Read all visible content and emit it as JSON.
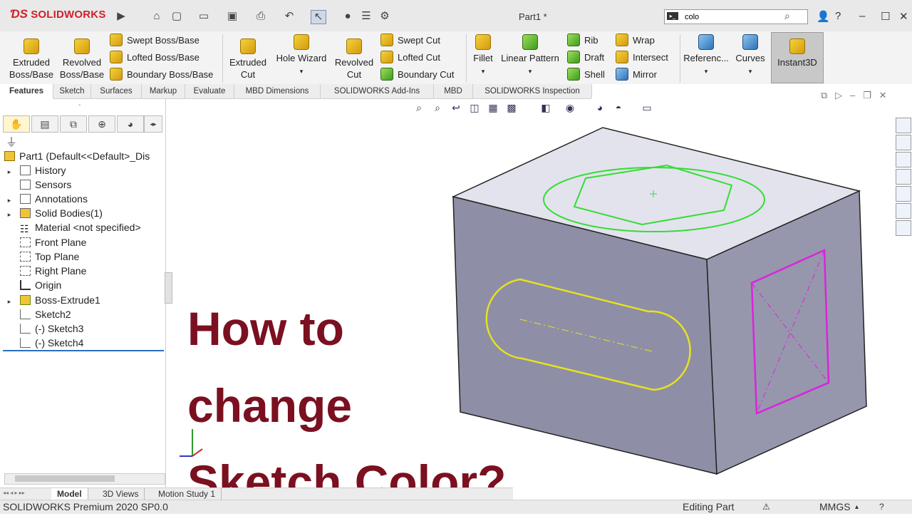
{
  "app": {
    "logo": "SOLIDWORKS",
    "document_title": "Part1 *"
  },
  "search": {
    "value": "colo"
  },
  "ribbon": {
    "extruded_boss": "Extruded Boss/Base",
    "revolved_boss": "Revolved Boss/Base",
    "swept_boss": "Swept Boss/Base",
    "lofted_boss": "Lofted Boss/Base",
    "boundary_boss": "Boundary Boss/Base",
    "extruded_cut": "Extruded Cut",
    "hole_wizard": "Hole Wizard",
    "revolved_cut": "Revolved Cut",
    "swept_cut": "Swept Cut",
    "lofted_cut": "Lofted Cut",
    "boundary_cut": "Boundary Cut",
    "fillet": "Fillet",
    "linear_pattern": "Linear Pattern",
    "rib": "Rib",
    "draft": "Draft",
    "shell": "Shell",
    "wrap": "Wrap",
    "intersect": "Intersect",
    "mirror": "Mirror",
    "reference": "Referenc...",
    "curves": "Curves",
    "instant3d": "Instant3D"
  },
  "tabs": [
    "Features",
    "Sketch",
    "Surfaces",
    "Markup",
    "Evaluate",
    "MBD Dimensions",
    "SOLIDWORKS Add-Ins",
    "MBD",
    "SOLIDWORKS Inspection"
  ],
  "tree": {
    "root": "Part1  (Default<<Default>_Dis",
    "items": [
      "History",
      "Sensors",
      "Annotations",
      "Solid Bodies(1)",
      "Material <not specified>",
      "Front Plane",
      "Top Plane",
      "Right Plane",
      "Origin",
      "Boss-Extrude1",
      "Sketch2",
      "(-) Sketch3",
      "(-) Sketch4"
    ]
  },
  "headline": {
    "line1": "How to",
    "line2": "change",
    "line3": "Sketch Color?"
  },
  "bottom_tabs": [
    "Model",
    "3D Views",
    "Motion Study 1"
  ],
  "status": {
    "product": "SOLIDWORKS Premium 2020 SP0.0",
    "mode": "Editing Part",
    "units": "MMGS"
  },
  "colors": {
    "sketch2": "#33dd33",
    "sketch3": "#e8e020",
    "sketch4": "#dd22dd",
    "headline": "#7a1020"
  }
}
